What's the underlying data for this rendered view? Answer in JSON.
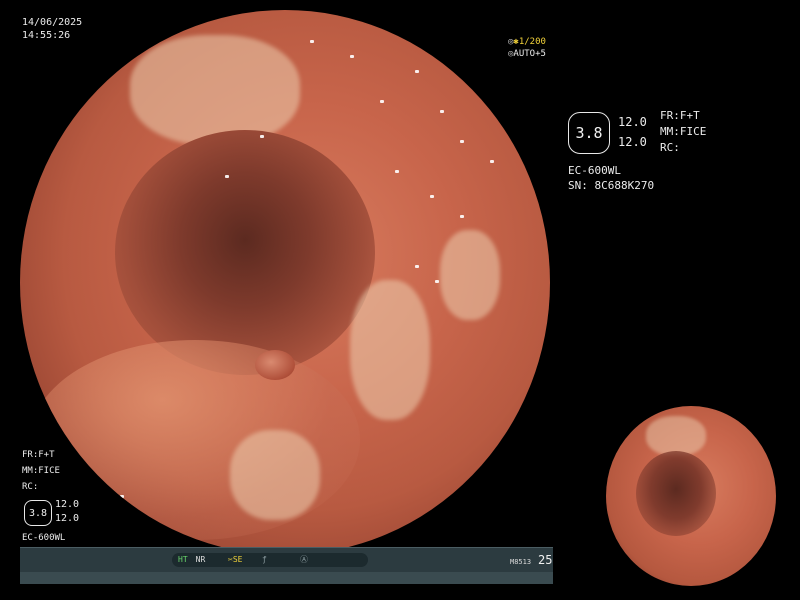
{
  "header": {
    "date": "14/06/2025",
    "time": "14:55:26"
  },
  "zoom": {
    "magnification": "✱1/200",
    "auto": "AUTO+5",
    "mag_icon": "magnifier-icon",
    "auto_icon": "auto-exposure-icon"
  },
  "right_panel": {
    "badge": "3.8",
    "value1": "12.0",
    "value2": "12.0",
    "model": "EC-600WL",
    "serial": "SN: 8C688K270",
    "fr": "FR:F+T",
    "mm": "MM:FICE",
    "rc": "RC:"
  },
  "left_panel": {
    "fr": "FR:F+T",
    "mm": "MM:FICE",
    "rc": "RC:",
    "badge": "3.8",
    "value1": "12.0",
    "value2": "12.0",
    "model": "EC-600WL"
  },
  "status_bar": {
    "ht": "HT",
    "nr": "NR",
    "se": "SE",
    "f_icon": "f-stop-icon",
    "a_icon": "auto-icon",
    "zoom_id": "M8513",
    "count": "25"
  },
  "colors": {
    "accent_yellow": "#f2d23a",
    "accent_green": "#68d46a",
    "bar": "#2c3b40"
  }
}
